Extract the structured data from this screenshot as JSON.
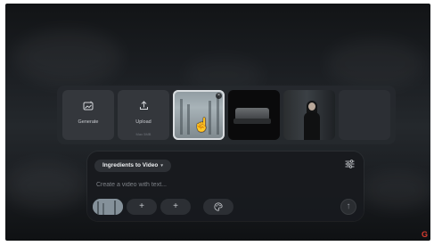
{
  "media_strip": {
    "generate": {
      "label": "Generate",
      "icon": "sparkle-image-icon"
    },
    "upload": {
      "label": "Upload",
      "sub": "Max 5MB",
      "icon": "upload-icon"
    },
    "thumbnails": [
      {
        "name": "foggy-forest-thumbnail",
        "selected": true
      },
      {
        "name": "couch-thumbnail",
        "selected": false
      },
      {
        "name": "person-thumbnail",
        "selected": false
      }
    ],
    "close_glyph": "×"
  },
  "composer": {
    "mode_label": "Ingredients to Video",
    "mode_chevron": "▾",
    "prompt_placeholder": "Create a video with text...",
    "add_glyph": "+",
    "palette_glyph": "◉",
    "send_glyph": "↑",
    "tune_glyph": "☰"
  },
  "colors": {
    "background": "#1b1e22",
    "panel": "#26292e",
    "accent_logo": "#d93b2f"
  },
  "logo_glyph": "G"
}
